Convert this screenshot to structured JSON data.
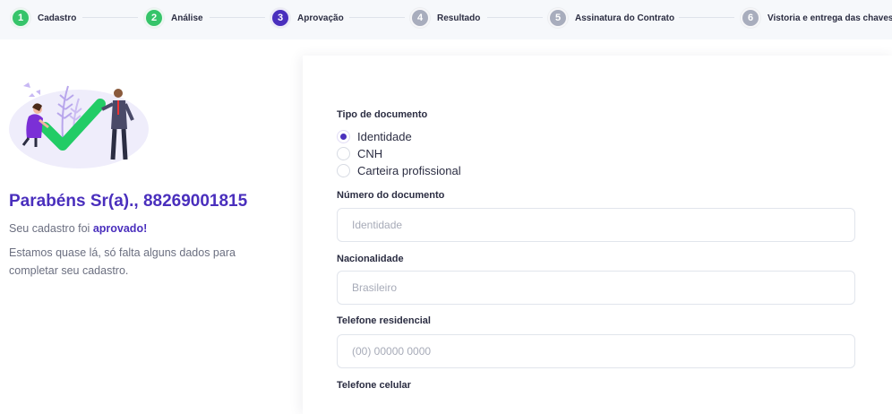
{
  "steps": [
    {
      "num": "1",
      "label": "Cadastro",
      "state": "done"
    },
    {
      "num": "2",
      "label": "Análise",
      "state": "done"
    },
    {
      "num": "3",
      "label": "Aprovação",
      "state": "active"
    },
    {
      "num": "4",
      "label": "Resultado",
      "state": "pending"
    },
    {
      "num": "5",
      "label": "Assinatura do Contrato",
      "state": "pending"
    },
    {
      "num": "6",
      "label": "Vistoria e entrega das chaves",
      "state": "pending"
    }
  ],
  "left": {
    "title": "Parabéns Sr(a)., 88269001815",
    "approved_prefix": "Seu cadastro foi ",
    "approved_strong": "aprovado!",
    "info": "Estamos quase lá, só falta alguns dados para completar seu cadastro."
  },
  "form": {
    "doc_type_label": "Tipo de documento",
    "doc_types": [
      "Identidade",
      "CNH",
      "Carteira profissional"
    ],
    "doc_type_selected": "Identidade",
    "doc_number_label": "Número do documento",
    "doc_number_placeholder": "Identidade",
    "nationality_label": "Nacionalidade",
    "nationality_placeholder": "Brasileiro",
    "home_phone_label": "Telefone residencial",
    "home_phone_placeholder": "(00) 00000 0000",
    "mobile_label": "Telefone celular"
  },
  "colors": {
    "primary": "#4a2fbd",
    "success": "#36c46a",
    "pending": "#a8adbd"
  }
}
